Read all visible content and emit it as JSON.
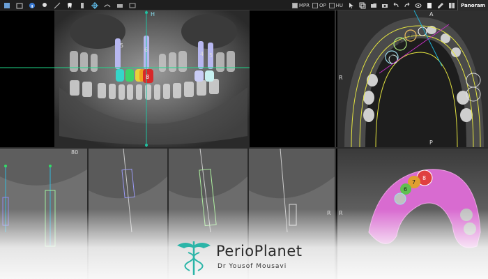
{
  "toolbar": {
    "left_icons": [
      "save-icon",
      "export-icon",
      "info-icon",
      "light-icon",
      "measure-icon",
      "tooth-icon",
      "implant-icon",
      "crosshair-icon",
      "nerve-icon",
      "print-icon",
      "screenshot-icon"
    ],
    "views": [
      {
        "label": "MPR",
        "checked": true
      },
      {
        "label": "OP",
        "checked": false
      },
      {
        "label": "HU",
        "checked": false
      }
    ],
    "right_icons": [
      "cursor-icon",
      "copy-icon",
      "folder-icon",
      "camera-icon",
      "undo-icon",
      "redo-icon",
      "eye-icon",
      "square-icon",
      "pen-icon",
      "layout-icon"
    ],
    "active_tab": "Panoram"
  },
  "panorama": {
    "axis_label": "H",
    "implants": [
      {
        "number": "5",
        "crown_color": "#35d6c9"
      },
      {
        "number": "",
        "crown_color": "#3cd46a"
      },
      {
        "number": "",
        "crown_color": "#e8d13a"
      },
      {
        "number": "6",
        "crown_color": "#f0a020"
      },
      {
        "number": "8",
        "crown_color": "#d8282a"
      },
      {
        "number": "4",
        "crown_color": "#9fa6f0"
      },
      {
        "number": "5",
        "crown_color": "#c7f0f0"
      }
    ]
  },
  "axial": {
    "label_top": "A",
    "label_bottom": "P",
    "label_right": "R",
    "implant_labels": [
      "7",
      "6",
      "5",
      "8"
    ]
  },
  "cross_sections": {
    "slice_number": "80",
    "side_label": "R"
  },
  "model3d": {
    "side_label": "R",
    "implant_labels": [
      "7",
      "6",
      "8"
    ]
  },
  "logo": {
    "name": "PerioPlanet",
    "subtitle": "Dr Yousof Mousavi",
    "color": "#2bb5a8"
  },
  "colors": {
    "crosshair": "#1fd88a",
    "axis_vertical": "#20c0a0",
    "arch_curve": "#e6e640",
    "model_pink": "#d86bd0"
  }
}
